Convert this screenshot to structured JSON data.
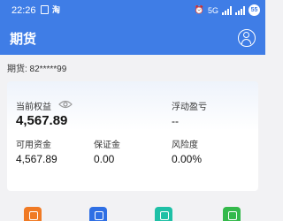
{
  "status_bar": {
    "time": "22:26",
    "app_icon_label": "淘",
    "signal_labels": "5G",
    "battery": "55"
  },
  "app_bar": {
    "title": "期货"
  },
  "account": {
    "text": "期货: 82*****99"
  },
  "summary": {
    "equity_label": "当前权益",
    "equity_value": "4,567.89",
    "floating_pl_label": "浮动盈亏",
    "floating_pl_value": "--",
    "available_label": "可用资金",
    "available_value": "4,567.89",
    "margin_label": "保证金",
    "margin_value": "0.00",
    "risk_label": "风险度",
    "risk_value": "0.00%"
  },
  "bottom_icons": [
    {
      "name": "orange-icon",
      "color": "#f07a24"
    },
    {
      "name": "blue-icon",
      "color": "#2f6fe4"
    },
    {
      "name": "teal-icon",
      "color": "#1fc0a6"
    },
    {
      "name": "green-icon",
      "color": "#34b94b"
    }
  ]
}
